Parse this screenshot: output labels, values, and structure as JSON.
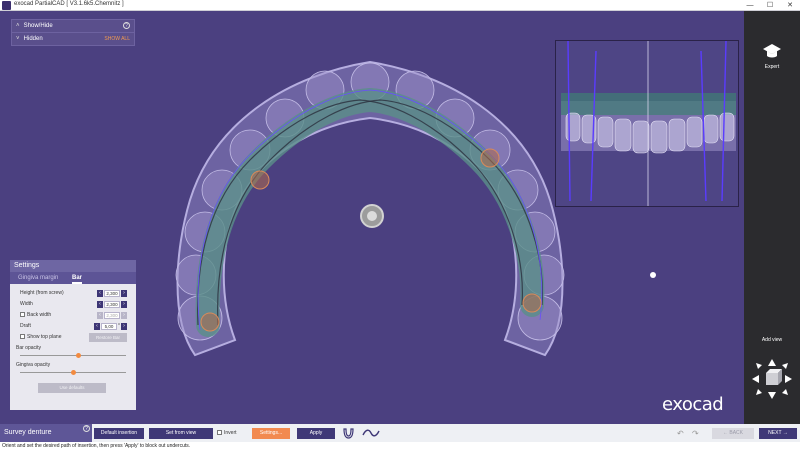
{
  "titlebar": {
    "title": "exocad PartialCAD [ V3.1.6k5.Chemnitz ]"
  },
  "show_panel": {
    "show_hide_label": "Show/Hide",
    "hidden_label": "Hidden",
    "show_all_label": "SHOW ALL"
  },
  "settings": {
    "title": "Settings",
    "tabs": [
      {
        "label": "Gingiva margin"
      },
      {
        "label": "Bar"
      }
    ],
    "rows": [
      {
        "label": "Height (from screw)",
        "value": "2,300"
      },
      {
        "label": "Width",
        "value": "2,300"
      },
      {
        "label": "Back width",
        "value": "2,300"
      },
      {
        "label": "Draft",
        "value": "5,00"
      }
    ],
    "draft_unit": "°",
    "show_top_plane_label": "Show top plane",
    "restore_bar_label": "Restore Bar",
    "bar_opacity_label": "Bar opacity",
    "bar_opacity": 0.55,
    "gingiva_opacity_label": "Gingiva opacity",
    "gingiva_opacity": 0.5,
    "use_defaults_label": "Use defaults"
  },
  "survey": {
    "label": "Survey denture"
  },
  "toolbar": {
    "default_insertion": "Default insertion",
    "set_from_view": "Set from view",
    "invert": "Invert",
    "settings": "Settings...",
    "apply": "Apply",
    "back": "BACK",
    "next": "NEXT"
  },
  "status": {
    "text": "Orient and set the desired path of insertion, then press 'Apply' to block out undercuts."
  },
  "rightbar": {
    "expert_label": "Expert",
    "add_view_label": "Add view"
  },
  "brand": {
    "logo": "exocad"
  },
  "colors": {
    "accent": "#f28a50",
    "panel": "#3f3877",
    "background": "#4b4080"
  }
}
